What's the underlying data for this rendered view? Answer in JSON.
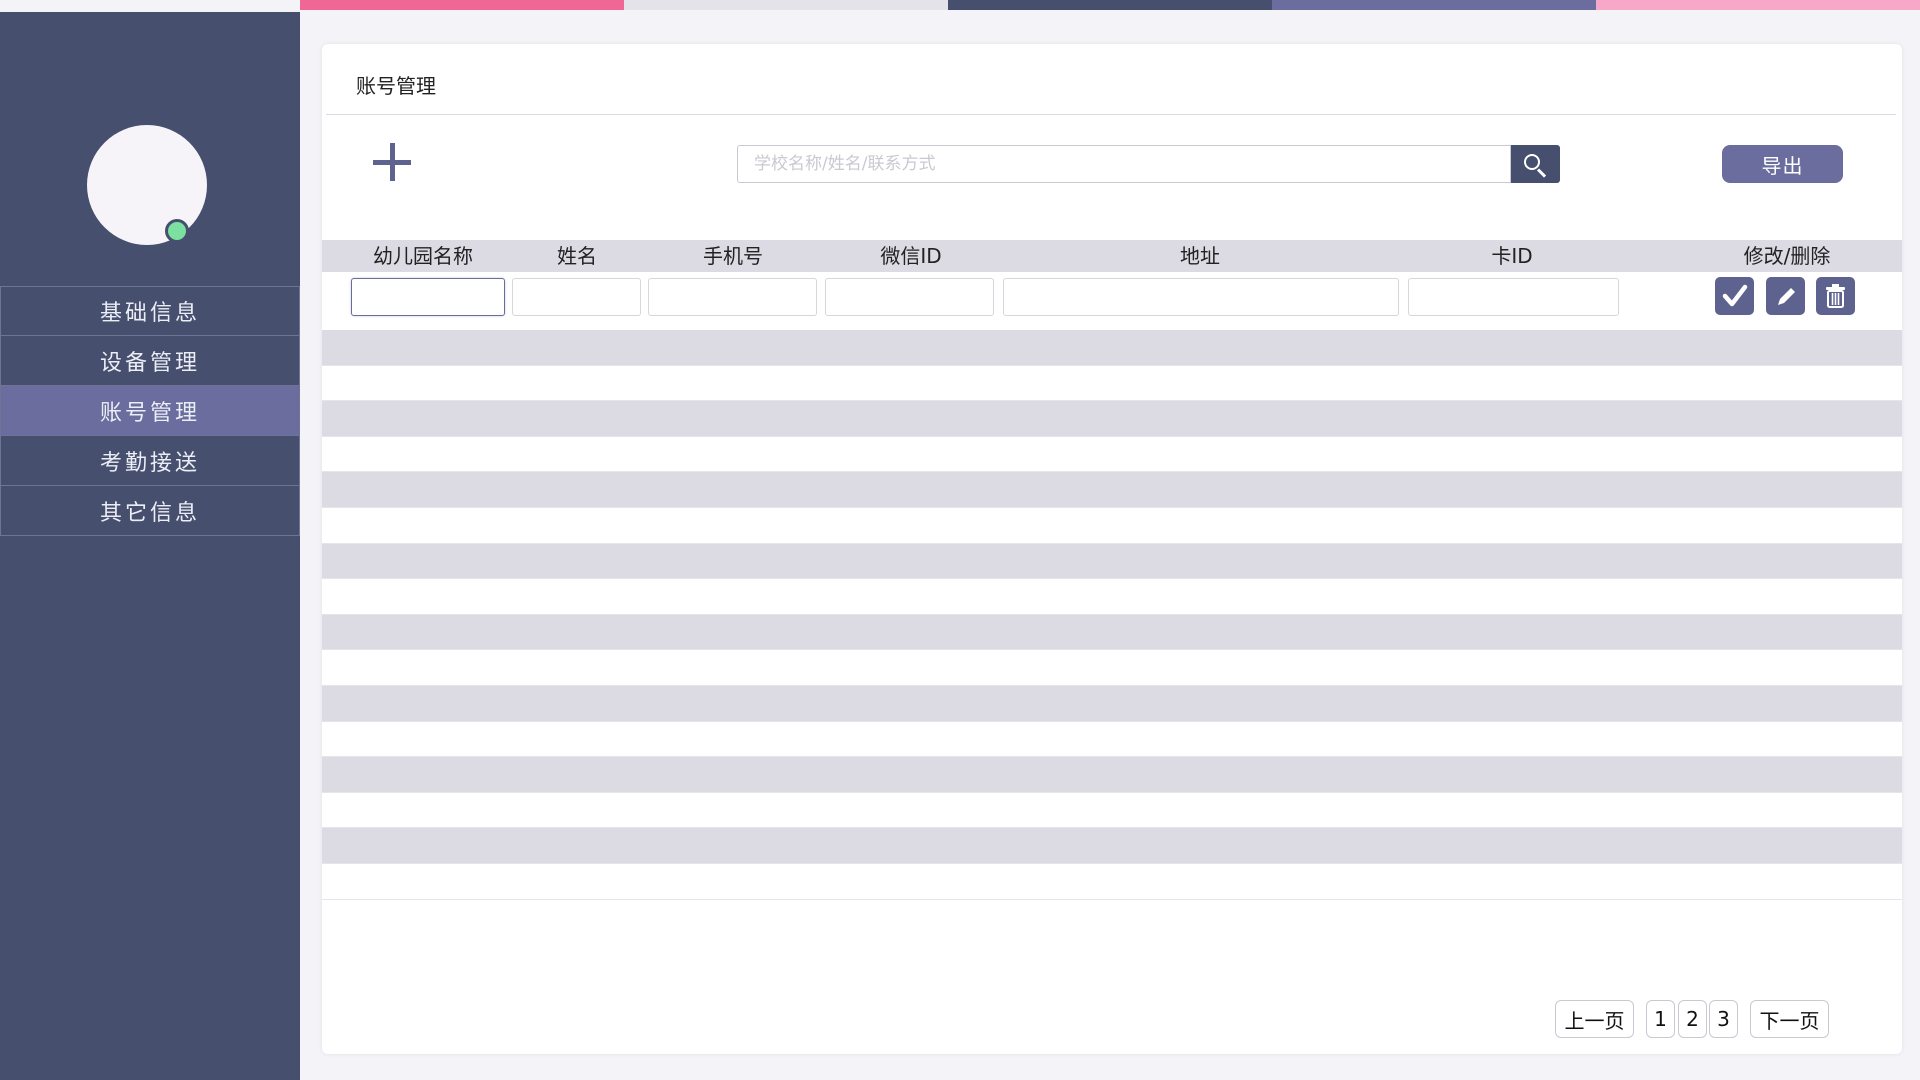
{
  "colors": {
    "sidebar_bg": "#464f6e",
    "accent": "#6a6d9d",
    "online_status": "#7be0a0",
    "row_shade": "#dcdbe4",
    "strip": [
      "#f06796",
      "#e4e3ea",
      "#464f6e",
      "#6a6d9d",
      "#f7a8c8"
    ]
  },
  "sidebar": {
    "avatar_icon": "user-avatar",
    "status_icon": "online-status-dot",
    "items": [
      {
        "label": "基础信息",
        "active": false
      },
      {
        "label": "设备管理",
        "active": false
      },
      {
        "label": "账号管理",
        "active": true
      },
      {
        "label": "考勤接送",
        "active": false
      },
      {
        "label": "其它信息",
        "active": false
      }
    ]
  },
  "main": {
    "title": "账号管理",
    "add_icon": "plus-icon",
    "search": {
      "placeholder": "学校名称/姓名/联系方式",
      "value": "",
      "icon": "search-icon"
    },
    "export_label": "导出"
  },
  "table": {
    "columns": [
      "幼儿园名称",
      "姓名",
      "手机号",
      "微信ID",
      "地址",
      "卡ID",
      "修改/删除"
    ],
    "edit_row_values": [
      "",
      "",
      "",
      "",
      "",
      ""
    ],
    "actions": [
      "check-icon",
      "pencil-icon",
      "trash-icon"
    ],
    "empty_rows": 16
  },
  "pagination": {
    "prev_label": "上一页",
    "pages": [
      "1",
      "2",
      "3"
    ],
    "next_label": "下一页"
  }
}
